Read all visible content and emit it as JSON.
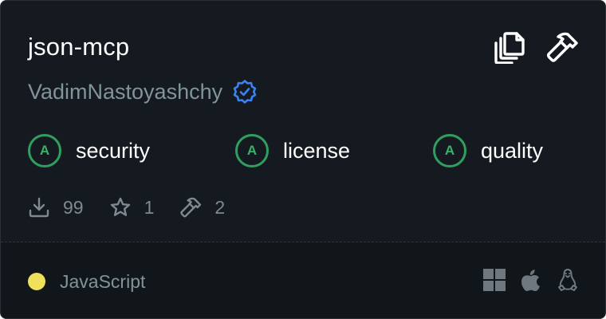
{
  "card": {
    "title": "json-mcp",
    "author": "VadimNastoyashchy",
    "verified_icon": "verified-badge-icon",
    "actions": [
      {
        "icon": "copy-icon"
      },
      {
        "icon": "hammer-icon"
      }
    ],
    "grades": [
      {
        "grade": "A",
        "label": "security"
      },
      {
        "grade": "A",
        "label": "license"
      },
      {
        "grade": "A",
        "label": "quality"
      }
    ],
    "stats": [
      {
        "icon": "download-icon",
        "value": "99"
      },
      {
        "icon": "star-icon",
        "value": "1"
      },
      {
        "icon": "hammer-icon",
        "value": "2"
      }
    ],
    "language": {
      "name": "JavaScript",
      "color": "#f1e05a"
    },
    "platforms": [
      {
        "icon": "windows-icon"
      },
      {
        "icon": "apple-icon"
      },
      {
        "icon": "linux-icon"
      }
    ]
  },
  "colors": {
    "background": "#141a1f",
    "footer_background": "#11161a",
    "grade_green": "#2f9e5e",
    "verified_blue": "#3b82f6",
    "muted_text": "#80949a"
  }
}
